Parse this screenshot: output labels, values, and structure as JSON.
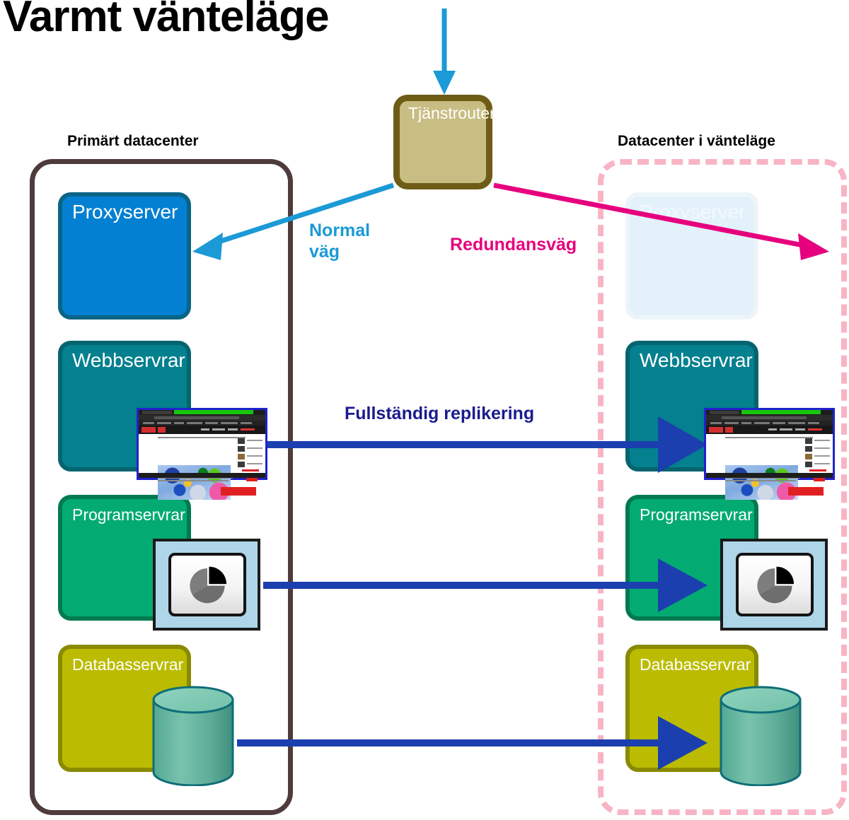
{
  "title": "Varmt vänteläge",
  "datacenters": {
    "primary": {
      "caption": "Primärt datacenter",
      "tiers": [
        {
          "key": "proxy",
          "label": "Proxyserver",
          "color": "#0380d2"
        },
        {
          "key": "web",
          "label": "Webbservrar",
          "color": "#04808f"
        },
        {
          "key": "app",
          "label": "Programservrar",
          "color": "#03ab72"
        },
        {
          "key": "db",
          "label": "Databasservrar",
          "color": "#bbbc02"
        }
      ],
      "border_color": "#4e3b3b",
      "border_style": "solid"
    },
    "standby": {
      "caption": "Datacenter i vänteläge",
      "tiers": [
        {
          "key": "proxy",
          "label": "Proxyserver",
          "color": "#e3f1fa",
          "state": "inactive"
        },
        {
          "key": "web",
          "label": "Webbservrar",
          "color": "#04808f",
          "state": "active"
        },
        {
          "key": "app",
          "label": "Programservrar",
          "color": "#03ab72",
          "state": "active"
        },
        {
          "key": "db",
          "label": "Databasservrar",
          "color": "#bbbc02",
          "state": "active"
        }
      ],
      "border_color": "#f8b4c4",
      "border_style": "dashed"
    }
  },
  "router": {
    "label": "Tjänstrouter",
    "fill": "#c8bd83",
    "border": "#6e5c16"
  },
  "connections": {
    "inbound": {
      "color": "#1b9ad6"
    },
    "normal_path": {
      "label": "Normal\nväg",
      "color": "#1b9ad6"
    },
    "redundant_path": {
      "label": "Redundansväg",
      "color": "#e6007e"
    },
    "replication": {
      "label": "Fullständig replikering",
      "color": "#1b1b8f"
    }
  },
  "icons": {
    "browser": "browser-window-icon",
    "pie": "pie-chart-icon",
    "database": "database-cylinder-icon"
  }
}
